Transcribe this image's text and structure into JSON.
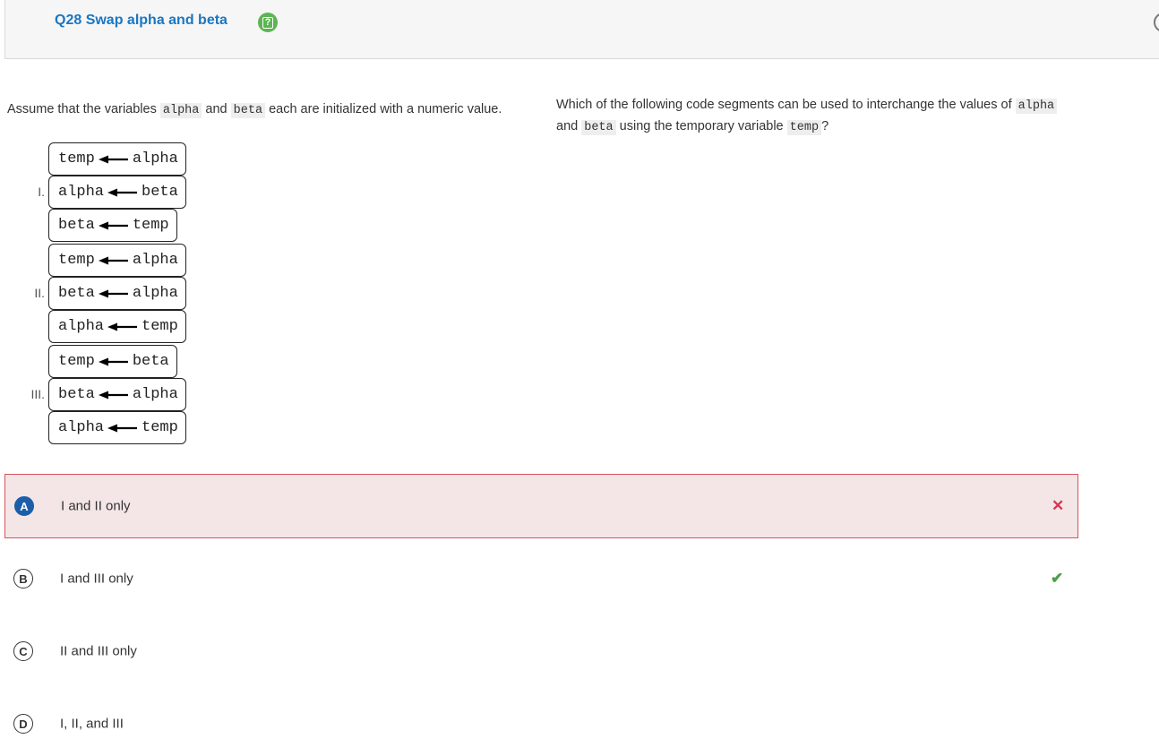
{
  "header": {
    "title": "Q28 Swap alpha and beta",
    "help_icon_glyph": "?"
  },
  "stem_left": {
    "p1": "Assume that the variables ",
    "v1": "alpha",
    "p2": " and ",
    "v2": "beta",
    "p3": " each are initialized with a numeric value."
  },
  "stem_right": {
    "p1": "Which of the following code segments can be used to interchange the values of ",
    "v1": "alpha",
    "p2": " and ",
    "v2": "beta",
    "p3": " using the temporary variable ",
    "v3": "temp",
    "p4": "?"
  },
  "segments": [
    {
      "label": "I.",
      "lines": [
        {
          "left": "temp",
          "right": "alpha"
        },
        {
          "left": "alpha",
          "right": "beta"
        },
        {
          "left": "beta",
          "right": "temp"
        }
      ]
    },
    {
      "label": "II.",
      "lines": [
        {
          "left": "temp",
          "right": "alpha"
        },
        {
          "left": "beta",
          "right": "alpha"
        },
        {
          "left": "alpha",
          "right": "temp"
        }
      ]
    },
    {
      "label": "III.",
      "lines": [
        {
          "left": "temp",
          "right": "beta"
        },
        {
          "left": "beta",
          "right": "alpha"
        },
        {
          "left": "alpha",
          "right": "temp"
        }
      ]
    }
  ],
  "answers": [
    {
      "letter": "A",
      "text": "I and II only",
      "status": "incorrect",
      "mark": "✕",
      "mark_color": "#d9364f"
    },
    {
      "letter": "B",
      "text": "I and III only",
      "status": "correct",
      "mark": "✔",
      "mark_color": "#4aa04a"
    },
    {
      "letter": "C",
      "text": "II and III only",
      "status": "",
      "mark": "",
      "mark_color": ""
    },
    {
      "letter": "D",
      "text": "I, II, and III",
      "status": "",
      "mark": "",
      "mark_color": ""
    }
  ]
}
